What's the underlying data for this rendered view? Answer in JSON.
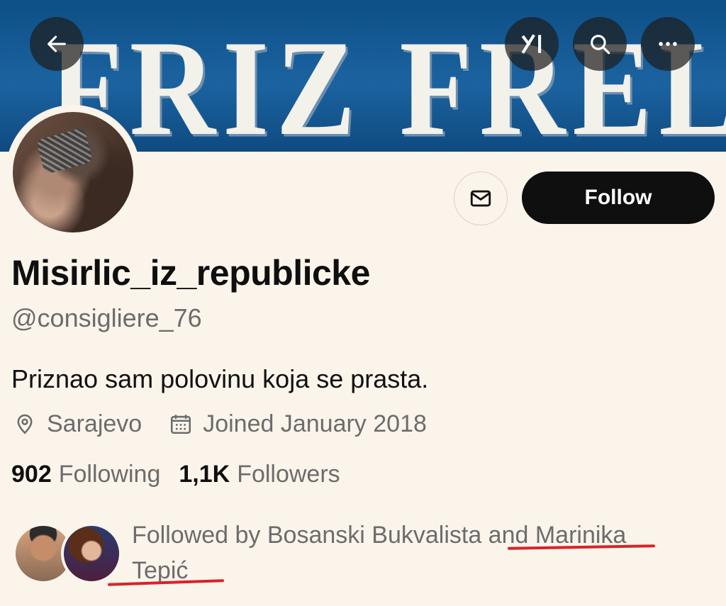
{
  "header": {
    "banner_text": "FRIZ FRELENG",
    "back_icon": "arrow-left-icon",
    "grok_icon": "grok-icon",
    "search_icon": "search-icon",
    "more_icon": "more-horizontal-icon"
  },
  "actions": {
    "message_icon": "envelope-icon",
    "follow_label": "Follow"
  },
  "profile": {
    "display_name": "Misirlic_iz_republicke",
    "handle": "@consigliere_76",
    "bio": "Priznao sam polovinu koja se prasta.",
    "location": "Sarajevo",
    "joined": "Joined January 2018"
  },
  "stats": {
    "following_count": "902",
    "following_label": "Following",
    "followers_count": "1,1K",
    "followers_label": "Followers"
  },
  "followed_by": {
    "text": "Followed by Bosanski Bukvalista and Marinika Tepić"
  },
  "colors": {
    "background": "#fbf4ea",
    "banner": "#1b63a0",
    "follow_button": "#0f0f0f",
    "annotation_underline": "#d8232a"
  }
}
